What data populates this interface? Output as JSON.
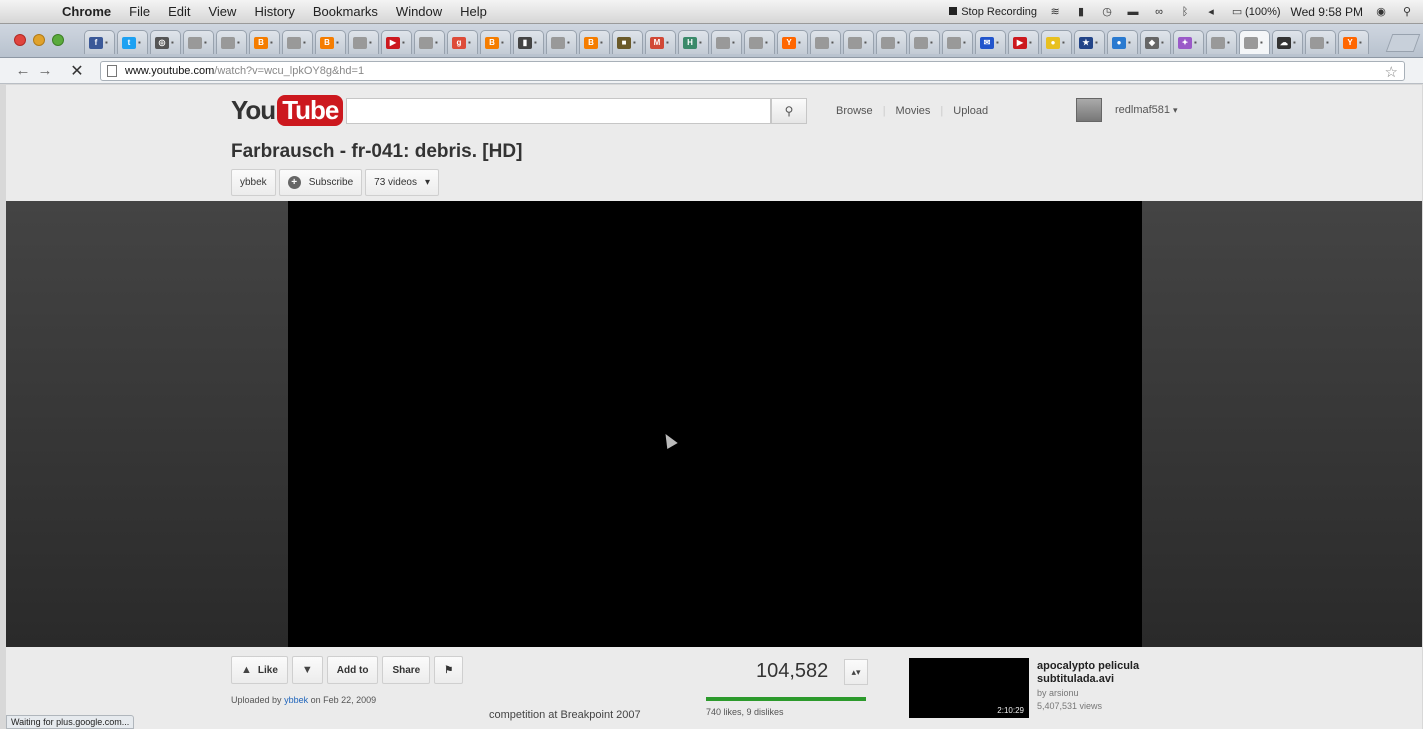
{
  "menubar": {
    "app": "Chrome",
    "items": [
      "File",
      "Edit",
      "View",
      "History",
      "Bookmarks",
      "Window",
      "Help"
    ],
    "recording": "Stop Recording",
    "battery": "(100%)",
    "clock": "Wed 9:58 PM"
  },
  "toolbar": {
    "url_host": "www.youtube.com",
    "url_path": "/watch?v=wcu_lpkOY8g&hd=1"
  },
  "tabs": [
    {
      "icon": "facebook-icon",
      "color": "#3b5998",
      "glyph": "f"
    },
    {
      "icon": "twitter-icon",
      "color": "#1da1f2",
      "glyph": "t"
    },
    {
      "icon": "instagram-icon",
      "color": "#555555",
      "glyph": "◎"
    },
    {
      "icon": "page-icon",
      "color": "#999999",
      "glyph": ""
    },
    {
      "icon": "page-icon",
      "color": "#999999",
      "glyph": ""
    },
    {
      "icon": "blogger-icon",
      "color": "#f57d00",
      "glyph": "B"
    },
    {
      "icon": "page-icon",
      "color": "#999999",
      "glyph": ""
    },
    {
      "icon": "blogger-icon",
      "color": "#f57d00",
      "glyph": "B"
    },
    {
      "icon": "page-icon",
      "color": "#999999",
      "glyph": ""
    },
    {
      "icon": "video-icon",
      "color": "#cc181e",
      "glyph": "▶"
    },
    {
      "icon": "page-icon",
      "color": "#999999",
      "glyph": ""
    },
    {
      "icon": "google-plus-icon",
      "color": "#dd4b39",
      "glyph": "g"
    },
    {
      "icon": "blogger-icon",
      "color": "#f57d00",
      "glyph": "B"
    },
    {
      "icon": "chart-icon",
      "color": "#444444",
      "glyph": "▮"
    },
    {
      "icon": "page-icon",
      "color": "#999999",
      "glyph": ""
    },
    {
      "icon": "blogger-icon",
      "color": "#f57d00",
      "glyph": "B"
    },
    {
      "icon": "photo-icon",
      "color": "#6b5a2a",
      "glyph": "■"
    },
    {
      "icon": "gmail-icon",
      "color": "#d14836",
      "glyph": "M"
    },
    {
      "icon": "h-icon",
      "color": "#3a8a6a",
      "glyph": "H"
    },
    {
      "icon": "page-icon",
      "color": "#999999",
      "glyph": ""
    },
    {
      "icon": "page-icon",
      "color": "#999999",
      "glyph": ""
    },
    {
      "icon": "ycombinator-icon",
      "color": "#ff6600",
      "glyph": "Y"
    },
    {
      "icon": "page-icon",
      "color": "#999999",
      "glyph": ""
    },
    {
      "icon": "page-icon",
      "color": "#999999",
      "glyph": ""
    },
    {
      "icon": "page-icon",
      "color": "#999999",
      "glyph": ""
    },
    {
      "icon": "page-icon",
      "color": "#999999",
      "glyph": ""
    },
    {
      "icon": "page-icon",
      "color": "#999999",
      "glyph": ""
    },
    {
      "icon": "chat-icon",
      "color": "#2255cc",
      "glyph": "✉"
    },
    {
      "icon": "youtube-icon",
      "color": "#cc181e",
      "glyph": "▶"
    },
    {
      "icon": "yellow-icon",
      "color": "#e8c020",
      "glyph": "●"
    },
    {
      "icon": "star-person-icon",
      "color": "#224488",
      "glyph": "★"
    },
    {
      "icon": "globe-icon",
      "color": "#2a7ad0",
      "glyph": "●"
    },
    {
      "icon": "puzzle-icon",
      "color": "#666666",
      "glyph": "◆"
    },
    {
      "icon": "purple-icon",
      "color": "#9a5ac8",
      "glyph": "✦"
    },
    {
      "icon": "page-icon",
      "color": "#999999",
      "glyph": ""
    },
    {
      "icon": "page-icon",
      "color": "#999999",
      "glyph": ""
    },
    {
      "icon": "cloud-icon",
      "color": "#333333",
      "glyph": "☁"
    },
    {
      "icon": "page-icon",
      "color": "#999999",
      "glyph": ""
    },
    {
      "icon": "ycombinator-icon",
      "color": "#ff6600",
      "glyph": "Y"
    }
  ],
  "youtube": {
    "logo_you": "You",
    "logo_tube": "Tube",
    "links": [
      "Browse",
      "Movies",
      "Upload"
    ],
    "username": "redlmaf581",
    "title": "Farbrausch - fr-041: debris. [HD]",
    "channel": "ybbek",
    "subscribe": "Subscribe",
    "videos": "73 videos",
    "actions": {
      "like": "Like",
      "add_to": "Add to",
      "share": "Share"
    },
    "uploaded_prefix": "Uploaded by",
    "uploader": "ybbek",
    "uploaded_date": "on Feb 22, 2009",
    "description_visible": "competition at Breakpoint 2007",
    "views": "104,582",
    "like_stats": "740 likes, 9 dislikes",
    "like_ratio": 0.988,
    "related": {
      "title": "apocalypto pelicula subtitulada.avi",
      "by": "by arsionu",
      "views": "5,407,531 views",
      "duration": "2:10:29"
    }
  },
  "status": "Waiting for plus.google.com..."
}
